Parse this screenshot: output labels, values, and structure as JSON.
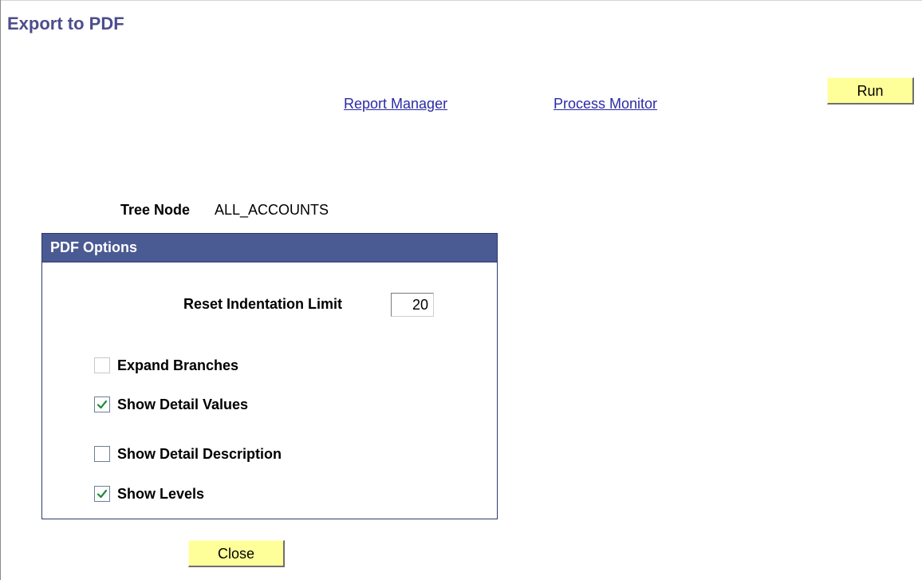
{
  "page": {
    "title": "Export to PDF"
  },
  "links": {
    "report_manager": "Report Manager",
    "process_monitor": "Process Monitor"
  },
  "buttons": {
    "run": "Run",
    "close": "Close",
    "color": "#ffff99"
  },
  "tree_node": {
    "label": "Tree Node",
    "value": "ALL_ACCOUNTS"
  },
  "pdf_options": {
    "title": "PDF Options",
    "header_color": "#4a5a92",
    "reset_indentation_limit": {
      "label": "Reset Indentation Limit",
      "value": "20"
    },
    "checkboxes": [
      {
        "label": "Expand Branches",
        "checked": false,
        "disabled": true
      },
      {
        "label": "Show Detail Values",
        "checked": true,
        "disabled": false
      },
      {
        "label": "Show Detail Description",
        "checked": false,
        "disabled": false
      },
      {
        "label": "Show Levels",
        "checked": true,
        "disabled": false
      }
    ],
    "check_color": "#1f8a3a"
  }
}
